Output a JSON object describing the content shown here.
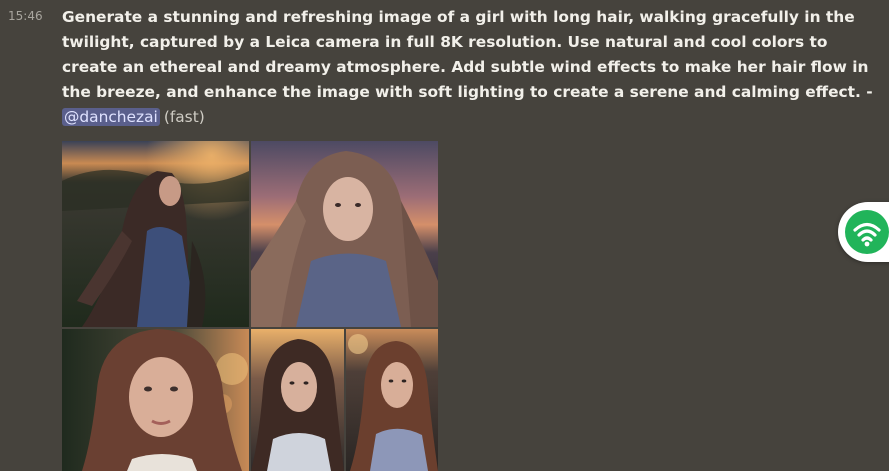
{
  "message": {
    "timestamp": "15:46",
    "prompt_lines": [
      "Generate a stunning and refreshing image of a girl with long hair, walking gracefully in the",
      "twilight, captured by a Leica camera in full 8K resolution. Use natural and cool colors to",
      "create an ethereal and dreamy atmosphere. Add subtle wind effects to make her hair flow in",
      "the breeze, and enhance the image with soft lighting to create a serene and calming effect. -"
    ],
    "mention": "@danchezai",
    "mode": "(fast)"
  },
  "images": [
    {
      "name": "generated-image-1"
    },
    {
      "name": "generated-image-2"
    },
    {
      "name": "generated-image-3"
    },
    {
      "name": "generated-image-4"
    },
    {
      "name": "generated-image-5"
    }
  ],
  "floating_badge": {
    "icon": "wifi-icon",
    "color": "#21b45a"
  },
  "colors": {
    "background": "#46433d",
    "text": "#f2f0ea",
    "mention_bg": "#5a5f8c",
    "timestamp": "#a8a59e"
  }
}
